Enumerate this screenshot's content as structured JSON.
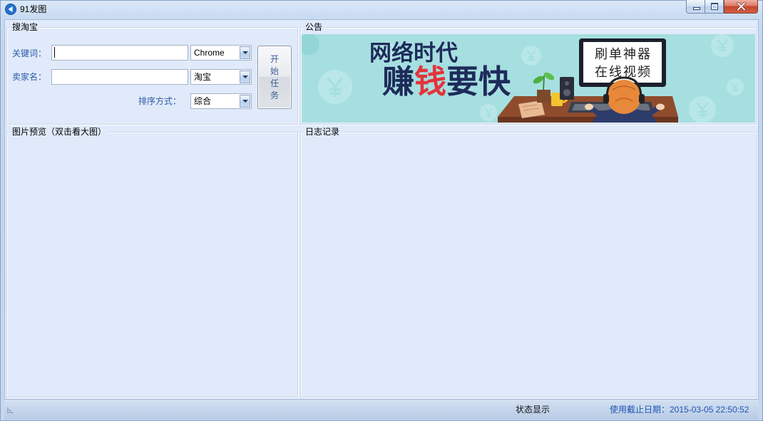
{
  "window": {
    "title": "91发图",
    "icons": {
      "app": "app-logo-icon",
      "minimize": "minimize-icon",
      "maximize": "maximize-icon",
      "close": "close-icon"
    }
  },
  "search_group": {
    "title": "搜淘宝",
    "keyword_label": "关键词：",
    "keyword_value": "",
    "browser_select": "Chrome",
    "seller_label": "卖家名：",
    "seller_value": "",
    "platform_select": "淘宝",
    "sort_label": "排序方式：",
    "sort_select": "综合",
    "start_button_label": "开始任务",
    "dropdown_icon": "chevron-down-icon"
  },
  "notice_group": {
    "title": "公告",
    "banner": {
      "headline_line1": "网络时代",
      "headline_line2_part1": "赚",
      "headline_line2_part2": "钱",
      "headline_line2_part3": "要快",
      "screen_line1": "刷单神器",
      "screen_line2": "在线视频"
    }
  },
  "preview_group": {
    "title": "图片预览（双击看大图）"
  },
  "log_group": {
    "title": "日志记录"
  },
  "status_bar": {
    "status_text": "状态显示",
    "expiry_text": "使用截止日期：2015-03-05 22:50:52",
    "grip_icon": "resize-grip-icon"
  },
  "colors": {
    "client_background": "#e0eafa",
    "label_text": "#2c5aa9",
    "expiry_text": "#1f55b5",
    "banner_background": "#a6dfe0",
    "headline_navy": "#1e2b5a",
    "headline_red": "#e3333b",
    "close_button": "#c5432d"
  }
}
